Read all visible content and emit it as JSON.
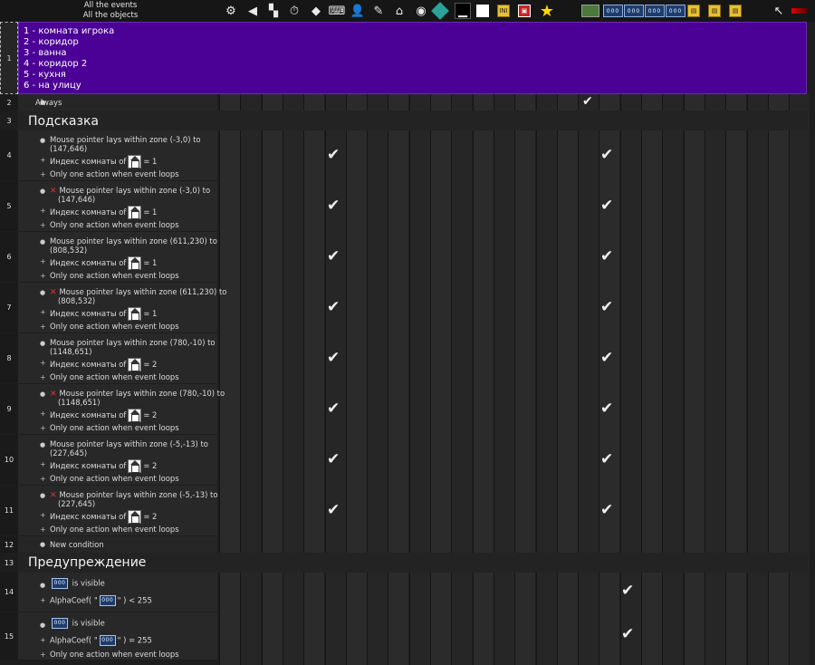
{
  "header": {
    "events_label": "All the events",
    "objects_label": "All the objects"
  },
  "toolbar_icons": [
    {
      "name": "gears-icon",
      "glyph": "⚙"
    },
    {
      "name": "speaker-icon",
      "glyph": "◀"
    },
    {
      "name": "network-icon",
      "glyph": "▚"
    },
    {
      "name": "timer-icon",
      "glyph": "⏱"
    },
    {
      "name": "eraser-icon",
      "glyph": "◆"
    },
    {
      "name": "keyboard-icon",
      "glyph": "⌨"
    },
    {
      "name": "user-icon",
      "glyph": "👤"
    },
    {
      "name": "pencil-icon",
      "glyph": "✎"
    },
    {
      "name": "room-icon",
      "glyph": "⌂"
    },
    {
      "name": "disc-icon",
      "glyph": "◉"
    },
    {
      "name": "diamond-icon",
      "glyph": ""
    },
    {
      "name": "black-screen-icon",
      "glyph": "▁"
    },
    {
      "name": "white-square-icon",
      "glyph": ""
    },
    {
      "name": "ini-file-icon",
      "glyph": "INI"
    },
    {
      "name": "save-disk-icon",
      "glyph": "▣"
    },
    {
      "name": "star-icon",
      "glyph": "★"
    },
    {
      "name": "picture-icon",
      "glyph": ""
    },
    {
      "name": "counter-object-icon-1",
      "glyph": "000"
    },
    {
      "name": "counter-object-icon-2",
      "glyph": "000"
    },
    {
      "name": "counter-object-icon-3",
      "glyph": "000"
    },
    {
      "name": "counter-object-icon-4",
      "glyph": "000"
    },
    {
      "name": "folder-icon-1",
      "glyph": "▤"
    },
    {
      "name": "folder-icon-2",
      "glyph": "▤"
    },
    {
      "name": "folder-icon-3",
      "glyph": "▤"
    },
    {
      "name": "cursor-icon",
      "glyph": "↖"
    },
    {
      "name": "health-bar-icon",
      "glyph": ""
    }
  ],
  "comment_lines": [
    "1 - комната игрока",
    "2 - коридор",
    "3 - ванна",
    "4 - коридор 2",
    "5 - кухня",
    "6 - на улицу"
  ],
  "rows": {
    "r1": "1",
    "r2": {
      "num": "2",
      "text": "Always"
    },
    "r3": {
      "num": "3",
      "title": "Подсказка"
    },
    "r12": {
      "num": "12",
      "text": "New condition"
    },
    "r13": {
      "num": "13",
      "title": "Предупреждение"
    }
  },
  "events": [
    {
      "num": "4",
      "negated": false,
      "zone_a": "Mouse pointer lays within zone (-3,0) to",
      "zone_b": "(147,646)",
      "room_prefix": "Индекс комнаты of",
      "room_eq": "= 1",
      "once": "Only one action when event loops"
    },
    {
      "num": "5",
      "negated": true,
      "zone_a": "Mouse pointer lays within zone (-3,0) to",
      "zone_b": "(147,646)",
      "room_prefix": "Индекс комнаты of",
      "room_eq": "= 1",
      "once": "Only one action when event loops"
    },
    {
      "num": "6",
      "negated": false,
      "zone_a": "Mouse pointer lays within zone (611,230) to",
      "zone_b": "(808,532)",
      "room_prefix": "Индекс комнаты of",
      "room_eq": "= 1",
      "once": "Only one action when event loops"
    },
    {
      "num": "7",
      "negated": true,
      "zone_a": "Mouse pointer lays within zone (611,230) to",
      "zone_b": "(808,532)",
      "room_prefix": "Индекс комнаты of",
      "room_eq": "= 1",
      "once": "Only one action when event loops"
    },
    {
      "num": "8",
      "negated": false,
      "zone_a": "Mouse pointer lays within zone (780,-10) to",
      "zone_b": "(1148,651)",
      "room_prefix": "Индекс комнаты of",
      "room_eq": "= 2",
      "once": "Only one action when event loops"
    },
    {
      "num": "9",
      "negated": true,
      "zone_a": "Mouse pointer lays within zone (780,-10) to",
      "zone_b": "(1148,651)",
      "room_prefix": "Индекс комнаты of",
      "room_eq": "= 2",
      "once": "Only one action when event loops"
    },
    {
      "num": "10",
      "negated": false,
      "zone_a": "Mouse pointer lays within zone (-5,-13) to",
      "zone_b": "(227,645)",
      "room_prefix": "Индекс комнаты of",
      "room_eq": "= 2",
      "once": "Only one action when event loops"
    },
    {
      "num": "11",
      "negated": true,
      "zone_a": "Mouse pointer lays within zone (-5,-13) to",
      "zone_b": "(227,645)",
      "room_prefix": "Индекс комнаты of",
      "room_eq": "= 2",
      "once": "Only one action when event loops"
    }
  ],
  "warn_events": [
    {
      "num": "14",
      "visible": "is visible",
      "alpha_prefix": "AlphaCoef( \"",
      "alpha_suffix": "\" ) < 255"
    },
    {
      "num": "15",
      "visible": "is visible",
      "alpha_prefix": "AlphaCoef( \"",
      "alpha_suffix": "\" ) = 255",
      "once": "Only one action when event loops"
    }
  ],
  "icon_text": "000",
  "checkmark": "✔"
}
